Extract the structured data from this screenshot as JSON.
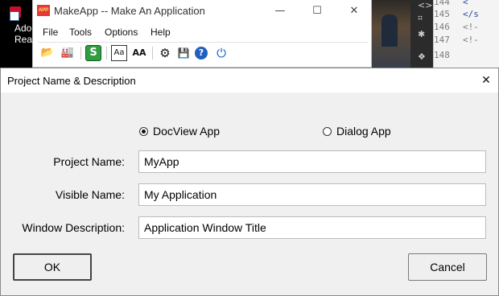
{
  "desktop": {
    "shortcut_text_line1": "Ado",
    "shortcut_text_line2": "Rea"
  },
  "editor": {
    "lines": [
      {
        "num": "144",
        "code": "<"
      },
      {
        "num": "145",
        "code": "</s"
      },
      {
        "num": "146",
        "code": "<!-"
      },
      {
        "num": "147",
        "code": "<!-"
      },
      {
        "num": "148",
        "code": ""
      }
    ],
    "gutter_glyphs": [
      "<>",
      "⌗",
      "✱",
      "❖"
    ]
  },
  "main_window": {
    "icon_text": "APP",
    "title": "MakeApp -- Make An Application",
    "menu": [
      "File",
      "Tools",
      "Options",
      "Help"
    ],
    "toolbar_icons": [
      {
        "name": "open-folder-icon",
        "glyph": "📂"
      },
      {
        "name": "build-icon",
        "glyph": "🏭"
      },
      {
        "name": "generate-icon",
        "glyph": "S"
      },
      {
        "name": "font-icon",
        "glyph": "Aa"
      },
      {
        "name": "font-size-icon",
        "glyph": "AA"
      },
      {
        "name": "settings-gear-icon",
        "glyph": "⚙"
      },
      {
        "name": "save-disk-icon",
        "glyph": "💾"
      },
      {
        "name": "help-icon",
        "glyph": "?"
      },
      {
        "name": "power-icon",
        "glyph": "⏻"
      }
    ]
  },
  "dialog": {
    "title": "Project Name & Description",
    "close_glyph": "✕",
    "radio_options": [
      {
        "label": "DocView App",
        "checked": true
      },
      {
        "label": "Dialog App",
        "checked": false
      }
    ],
    "fields": [
      {
        "label": "Project Name:",
        "value": "MyApp"
      },
      {
        "label": "Visible Name:",
        "value": "My Application"
      },
      {
        "label": "Window Description:",
        "value": "Application Window Title"
      }
    ],
    "ok_label": "OK",
    "cancel_label": "Cancel"
  },
  "colors": {
    "dialog_bg": "#f0f0f0",
    "app_icon_red": "#e53935",
    "help_blue": "#1f5fbf",
    "power_blue": "#1a5fd0"
  }
}
